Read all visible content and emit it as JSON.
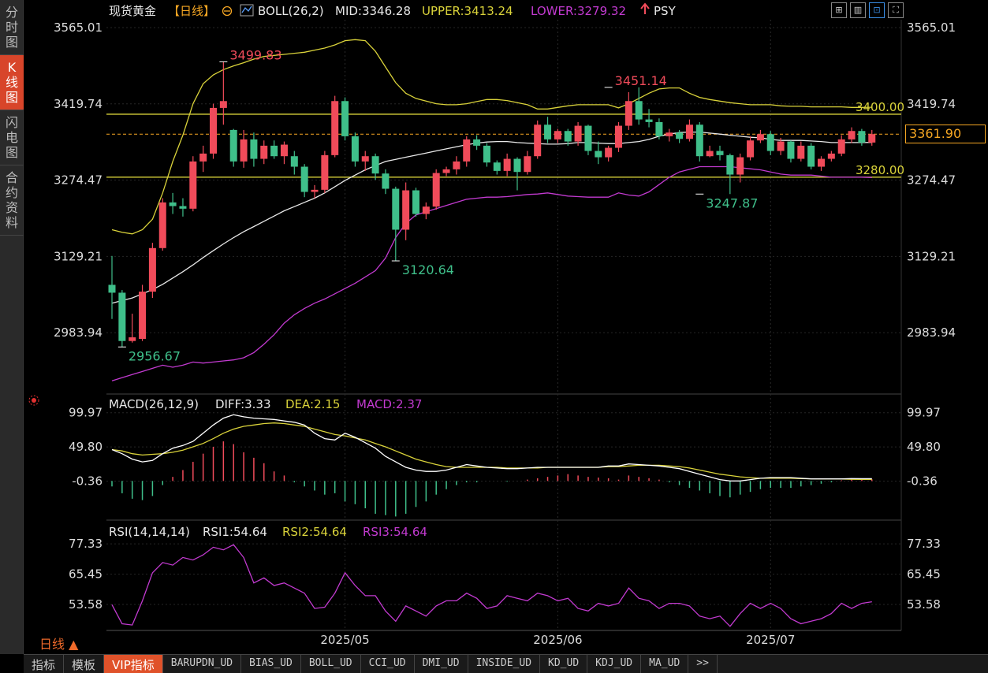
{
  "sidebar": {
    "tabs": [
      {
        "label": "分时图",
        "active": false
      },
      {
        "label": "K线图",
        "active": true
      },
      {
        "label": "闪电图",
        "active": false
      },
      {
        "label": "合约资料",
        "active": false
      }
    ]
  },
  "header": {
    "instrument": "现货黄金",
    "period_tag": "【日线】",
    "boll": "BOLL(26,2)",
    "mid": "MID:3346.28",
    "upper": "UPPER:3413.24",
    "lower": "LOWER:3279.32",
    "psy": "PSY"
  },
  "top_icons": [
    "grid-icon",
    "layout-icon",
    "chart-mode-icon",
    "fullscreen-icon"
  ],
  "period_selector": "日线 ▲",
  "last_price": "3361.90",
  "bottom_bar": {
    "items": [
      "指标",
      "模板",
      "VIP指标",
      "BARUPDN_UD",
      "BIAS_UD",
      "BOLL_UD",
      "CCI_UD",
      "DMI_UD",
      "INSIDE_UD",
      "KD_UD",
      "KDJ_UD",
      "MA_UD",
      ">>"
    ]
  },
  "colors": {
    "up": "#f04b5a",
    "down": "#3fbf8a",
    "mid": "#e8e8e8",
    "upper": "#d9d23a",
    "lower": "#c23ad0",
    "accent": "#f5a623"
  },
  "chart_data": [
    {
      "type": "candlestick",
      "name": "main",
      "y_ticks": [
        3565.01,
        3419.74,
        3274.47,
        3129.21,
        2983.94
      ],
      "ylim": [
        2870,
        3580
      ],
      "x_labels": [
        {
          "label": "2025/05",
          "index": 23
        },
        {
          "label": "2025/06",
          "index": 44
        },
        {
          "label": "2025/07",
          "index": 65
        }
      ],
      "annotations": [
        {
          "text": "3499.83",
          "index": 11,
          "value": 3499.83,
          "kind": "high"
        },
        {
          "text": "3451.14",
          "index": 49,
          "value": 3451.14,
          "kind": "high"
        },
        {
          "text": "2956.67",
          "index": 1,
          "value": 2956.67,
          "kind": "low"
        },
        {
          "text": "3120.64",
          "index": 28,
          "value": 3120.64,
          "kind": "low"
        },
        {
          "text": "3247.87",
          "index": 58,
          "value": 3247.87,
          "kind": "low"
        }
      ],
      "hlines": [
        {
          "label": "3400.00",
          "value": 3400.0
        },
        {
          "label": "3280.00",
          "value": 3280.0
        }
      ],
      "last_price": 3361.9,
      "candles": [
        [
          3075,
          3130,
          3010,
          3060
        ],
        [
          3060,
          3065,
          2956.67,
          2968
        ],
        [
          2968,
          3020,
          2965,
          2975
        ],
        [
          2972,
          3075,
          2968,
          3062
        ],
        [
          3062,
          3155,
          3050,
          3145
        ],
        [
          3145,
          3240,
          3140,
          3232
        ],
        [
          3232,
          3250,
          3210,
          3225
        ],
        [
          3225,
          3240,
          3205,
          3220
        ],
        [
          3220,
          3320,
          3215,
          3310
        ],
        [
          3310,
          3340,
          3290,
          3325
        ],
        [
          3325,
          3420,
          3315,
          3412
        ],
        [
          3412,
          3499.83,
          3380,
          3425
        ],
        [
          3370,
          3372,
          3300,
          3310
        ],
        [
          3310,
          3370,
          3298,
          3352
        ],
        [
          3352,
          3365,
          3300,
          3315
        ],
        [
          3315,
          3350,
          3305,
          3340
        ],
        [
          3340,
          3350,
          3315,
          3320
        ],
        [
          3320,
          3348,
          3305,
          3342
        ],
        [
          3320,
          3330,
          3285,
          3300
        ],
        [
          3300,
          3305,
          3242,
          3252
        ],
        [
          3252,
          3265,
          3240,
          3256
        ],
        [
          3256,
          3330,
          3250,
          3322
        ],
        [
          3322,
          3435,
          3318,
          3425
        ],
        [
          3425,
          3432,
          3350,
          3358
        ],
        [
          3358,
          3365,
          3300,
          3310
        ],
        [
          3310,
          3330,
          3292,
          3320
        ],
        [
          3320,
          3325,
          3275,
          3287
        ],
        [
          3287,
          3295,
          3248,
          3258
        ],
        [
          3258,
          3262,
          3120.64,
          3180
        ],
        [
          3180,
          3270,
          3160,
          3255
        ],
        [
          3255,
          3260,
          3205,
          3210
        ],
        [
          3210,
          3232,
          3200,
          3224
        ],
        [
          3224,
          3295,
          3218,
          3288
        ],
        [
          3288,
          3300,
          3282,
          3295
        ],
        [
          3295,
          3320,
          3285,
          3310
        ],
        [
          3310,
          3358,
          3300,
          3352
        ],
        [
          3352,
          3360,
          3332,
          3340
        ],
        [
          3340,
          3345,
          3300,
          3308
        ],
        [
          3308,
          3312,
          3285,
          3292
        ],
        [
          3292,
          3325,
          3282,
          3315
        ],
        [
          3315,
          3318,
          3255,
          3290
        ],
        [
          3290,
          3330,
          3285,
          3320
        ],
        [
          3320,
          3388,
          3315,
          3380
        ],
        [
          3380,
          3395,
          3345,
          3352
        ],
        [
          3352,
          3372,
          3345,
          3368
        ],
        [
          3368,
          3372,
          3340,
          3348
        ],
        [
          3348,
          3385,
          3340,
          3378
        ],
        [
          3378,
          3380,
          3322,
          3330
        ],
        [
          3330,
          3348,
          3305,
          3318
        ],
        [
          3318,
          3340,
          3310,
          3336
        ],
        [
          3336,
          3385,
          3328,
          3378
        ],
        [
          3378,
          3442,
          3370,
          3425
        ],
        [
          3425,
          3451.14,
          3380,
          3390
        ],
        [
          3390,
          3410,
          3375,
          3385
        ],
        [
          3385,
          3392,
          3352,
          3358
        ],
        [
          3358,
          3372,
          3348,
          3365
        ],
        [
          3365,
          3370,
          3345,
          3353
        ],
        [
          3353,
          3390,
          3348,
          3380
        ],
        [
          3380,
          3385,
          3310,
          3320
        ],
        [
          3320,
          3340,
          3318,
          3330
        ],
        [
          3330,
          3340,
          3312,
          3322
        ],
        [
          3322,
          3325,
          3247.87,
          3285
        ],
        [
          3285,
          3325,
          3270,
          3318
        ],
        [
          3318,
          3358,
          3312,
          3350
        ],
        [
          3350,
          3370,
          3345,
          3362
        ],
        [
          3362,
          3368,
          3322,
          3330
        ],
        [
          3330,
          3355,
          3322,
          3348
        ],
        [
          3348,
          3350,
          3308,
          3315
        ],
        [
          3315,
          3348,
          3310,
          3340
        ],
        [
          3340,
          3345,
          3295,
          3300
        ],
        [
          3300,
          3320,
          3292,
          3315
        ],
        [
          3315,
          3330,
          3310,
          3325
        ],
        [
          3325,
          3360,
          3320,
          3352
        ],
        [
          3352,
          3375,
          3345,
          3368
        ],
        [
          3368,
          3372,
          3340,
          3346
        ],
        [
          3346,
          3370,
          3340,
          3362
        ]
      ],
      "mid": [
        3040,
        3045,
        3050,
        3058,
        3066,
        3076,
        3088,
        3100,
        3113,
        3127,
        3140,
        3153,
        3165,
        3176,
        3186,
        3196,
        3206,
        3216,
        3224,
        3232,
        3240,
        3250,
        3262,
        3274,
        3284,
        3294,
        3302,
        3310,
        3314,
        3318,
        3322,
        3326,
        3330,
        3334,
        3338,
        3342,
        3345,
        3347,
        3348,
        3348,
        3346,
        3345,
        3344,
        3343,
        3343,
        3344,
        3346,
        3346,
        3345,
        3344,
        3344,
        3346,
        3348,
        3352,
        3358,
        3362,
        3365,
        3366,
        3366,
        3364,
        3362,
        3360,
        3358,
        3356,
        3355,
        3352,
        3350,
        3350,
        3350,
        3349,
        3348,
        3346,
        3346,
        3346,
        3346,
        3346.28
      ],
      "upper": [
        3180,
        3175,
        3172,
        3180,
        3200,
        3250,
        3310,
        3360,
        3420,
        3458,
        3475,
        3485,
        3492,
        3498,
        3505,
        3510,
        3512,
        3514,
        3516,
        3518,
        3522,
        3526,
        3532,
        3540,
        3542,
        3540,
        3520,
        3490,
        3460,
        3440,
        3430,
        3425,
        3420,
        3418,
        3418,
        3420,
        3424,
        3428,
        3428,
        3426,
        3422,
        3418,
        3410,
        3410,
        3413,
        3416,
        3418,
        3418,
        3418,
        3418,
        3412,
        3420,
        3430,
        3440,
        3448,
        3450,
        3450,
        3440,
        3432,
        3428,
        3425,
        3422,
        3420,
        3418,
        3418,
        3418,
        3416,
        3415,
        3415,
        3414,
        3414,
        3414,
        3414,
        3413,
        3413,
        3413.24
      ],
      "lower": [
        2892,
        2898,
        2904,
        2910,
        2916,
        2922,
        2918,
        2922,
        2928,
        2926,
        2928,
        2930,
        2932,
        2936,
        2946,
        2962,
        2980,
        3002,
        3018,
        3030,
        3040,
        3048,
        3058,
        3068,
        3078,
        3090,
        3102,
        3126,
        3165,
        3192,
        3208,
        3214,
        3220,
        3226,
        3232,
        3238,
        3240,
        3242,
        3242,
        3243,
        3245,
        3247,
        3248,
        3250,
        3247,
        3244,
        3243,
        3242,
        3242,
        3242,
        3250,
        3246,
        3244,
        3252,
        3266,
        3280,
        3290,
        3295,
        3300,
        3300,
        3300,
        3300,
        3298,
        3296,
        3294,
        3290,
        3286,
        3284,
        3284,
        3284,
        3282,
        3280,
        3280,
        3280,
        3280,
        3279.32
      ]
    },
    {
      "type": "bar+line",
      "name": "MACD(26,12,9)",
      "legend": [
        "DIFF:3.33",
        "DEA:2.15",
        "MACD:2.37"
      ],
      "y_ticks": [
        99.97,
        49.8,
        -0.36
      ],
      "ylim": [
        -55,
        110
      ],
      "diff": [
        46,
        40,
        32,
        28,
        30,
        40,
        48,
        52,
        58,
        70,
        82,
        92,
        97,
        94,
        92,
        91,
        90,
        88,
        86,
        82,
        70,
        62,
        60,
        70,
        64,
        56,
        48,
        36,
        28,
        20,
        16,
        14,
        14,
        16,
        20,
        24,
        22,
        20,
        19,
        18,
        18,
        19,
        20,
        20,
        20,
        20,
        20,
        20,
        20,
        22,
        22,
        25,
        24,
        23,
        22,
        20,
        18,
        14,
        10,
        6,
        2,
        0,
        0,
        2,
        4,
        5,
        5,
        5,
        4,
        3,
        3,
        3,
        3,
        3.5,
        3.4,
        3.33
      ],
      "dea": [
        46,
        44,
        40,
        38,
        39,
        40,
        42,
        45,
        50,
        55,
        62,
        70,
        76,
        80,
        82,
        84,
        85,
        84,
        82,
        80,
        76,
        72,
        68,
        66,
        63,
        60,
        55,
        50,
        44,
        38,
        32,
        28,
        24,
        21,
        20,
        20,
        20,
        20,
        20,
        19,
        19,
        19,
        19,
        20,
        20,
        20,
        20,
        20,
        20,
        21,
        21,
        22,
        23,
        23,
        23,
        22,
        21,
        19,
        16,
        13,
        10,
        8,
        6,
        5,
        4,
        4,
        4,
        4,
        3.5,
        3.2,
        3,
        3,
        2.8,
        2.5,
        2.3,
        2.15
      ],
      "macd": [
        -8,
        -18,
        -26,
        -28,
        -22,
        -6,
        6,
        16,
        28,
        40,
        50,
        58,
        54,
        42,
        34,
        26,
        14,
        8,
        -2,
        -8,
        -14,
        -20,
        -18,
        -30,
        -34,
        -40,
        -48,
        -50,
        -52,
        -48,
        -38,
        -30,
        -20,
        -12,
        -6,
        -2,
        -2,
        0,
        0,
        -1,
        0,
        2,
        4,
        6,
        8,
        10,
        8,
        6,
        5,
        4,
        2,
        8,
        6,
        4,
        2,
        -2,
        -6,
        -10,
        -14,
        -18,
        -22,
        -24,
        -20,
        -16,
        -12,
        -10,
        -10,
        -10,
        -8,
        -6,
        -4,
        -2,
        1,
        2,
        2.2,
        2.37
      ]
    },
    {
      "type": "line",
      "name": "RSI(14,14,14)",
      "legend": [
        "RSI1:54.64",
        "RSI2:54.64",
        "RSI3:54.64"
      ],
      "y_ticks": [
        77.33,
        65.45,
        53.58
      ],
      "ylim": [
        44,
        82
      ],
      "rsi": [
        53.5,
        46,
        45.5,
        55,
        66,
        70,
        69,
        72,
        71,
        73,
        76,
        75,
        77,
        72,
        62,
        64,
        61,
        62,
        60,
        58,
        52,
        52.5,
        58,
        66,
        61,
        57,
        57,
        51,
        47,
        53,
        51,
        49,
        53,
        55,
        55,
        58,
        56,
        52,
        53,
        57,
        56,
        55,
        58,
        57,
        55,
        56,
        52,
        51,
        54,
        53,
        54,
        60,
        56,
        55,
        52,
        54,
        54,
        53,
        49,
        48,
        49,
        45,
        50,
        54,
        52,
        54,
        52,
        48,
        46,
        47,
        48,
        50,
        54,
        52,
        54,
        54.64
      ]
    }
  ]
}
